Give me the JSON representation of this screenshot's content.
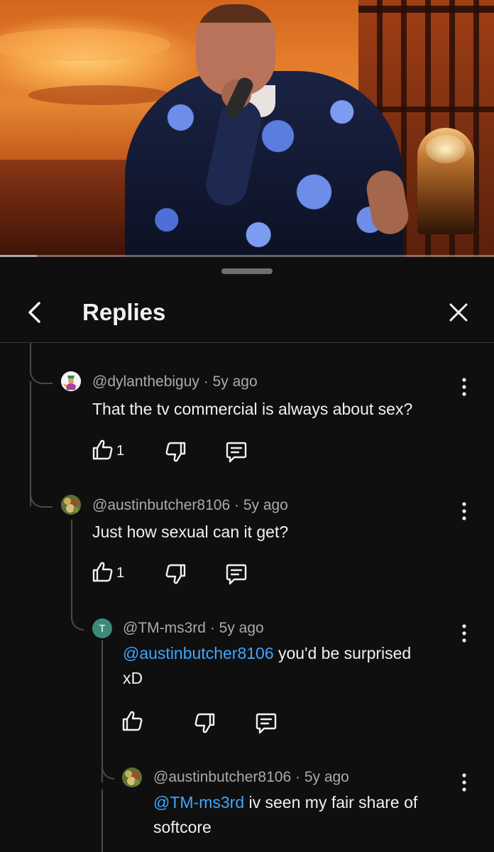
{
  "header": {
    "title": "Replies"
  },
  "comments": [
    {
      "author": "@dylanthebiguy",
      "age": "5y ago",
      "text": "That the tv commercial is always about sex?",
      "likes": "1"
    },
    {
      "author": "@austinbutcher8106",
      "age": "5y ago",
      "text": "Just how sexual can it get?",
      "likes": "1"
    },
    {
      "author": "@TM-ms3rd",
      "avatar_letter": "T",
      "age": "5y ago",
      "mention": "@austinbutcher8106",
      "text": " you'd be surprised",
      "text_line2": "xD",
      "likes": ""
    },
    {
      "author": "@austinbutcher8106",
      "age": "5y ago",
      "mention": "@TM-ms3rd",
      "text": " iv seen my fair share of",
      "text_line2": "softcore"
    }
  ],
  "separator": "·",
  "icons": [
    "back-arrow-icon",
    "close-icon",
    "like-icon",
    "dislike-icon",
    "reply-icon",
    "more-vert-icon"
  ],
  "colors": {
    "background": "#0f0f0f",
    "mention": "#3ea6ff",
    "meta": "#aaaaaa"
  }
}
